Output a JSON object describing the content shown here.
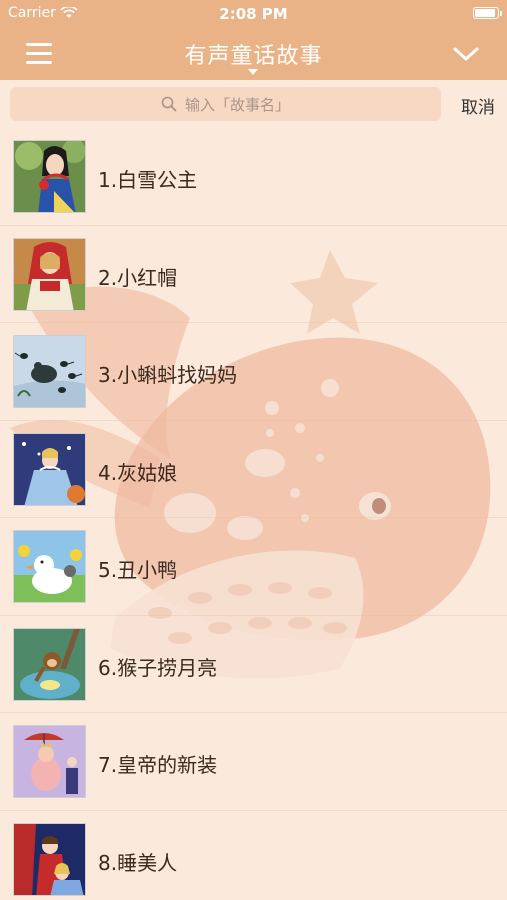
{
  "status_bar": {
    "carrier": "Carrier",
    "time": "2:08 PM"
  },
  "nav": {
    "title": "有声童话故事"
  },
  "search": {
    "placeholder": "输入「故事名」",
    "cancel_label": "取消"
  },
  "stories": [
    {
      "label": "1.白雪公主",
      "thumb": "snow-white-thumbnail"
    },
    {
      "label": "2.小红帽",
      "thumb": "little-red-riding-hood-thumbnail"
    },
    {
      "label": "3.小蝌蚪找妈妈",
      "thumb": "tadpoles-thumbnail"
    },
    {
      "label": "4.灰姑娘",
      "thumb": "cinderella-thumbnail"
    },
    {
      "label": "5.丑小鸭",
      "thumb": "ugly-duckling-thumbnail"
    },
    {
      "label": "6.猴子捞月亮",
      "thumb": "monkey-moon-thumbnail"
    },
    {
      "label": "7.皇帝的新装",
      "thumb": "emperor-new-clothes-thumbnail"
    },
    {
      "label": "8.睡美人",
      "thumb": "sleeping-beauty-thumbnail"
    }
  ],
  "colors": {
    "header": "#e9b387",
    "background": "#fbe9db",
    "search_field": "#f7d8c3"
  }
}
